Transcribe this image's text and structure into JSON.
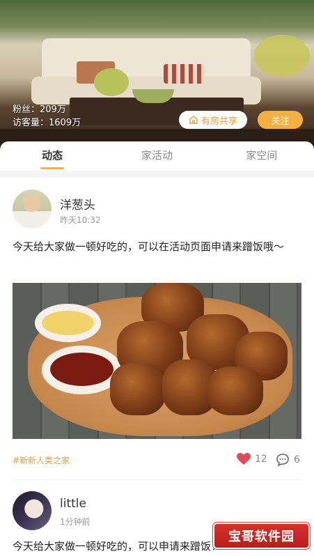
{
  "profile": {
    "fans": "粉丝：209万",
    "visitors": "访客量：1609万",
    "share_label": "有房共享",
    "follow_label": "关注"
  },
  "tabs": [
    {
      "label": "动态",
      "active": true
    },
    {
      "label": "家活动",
      "active": false
    },
    {
      "label": "家空间",
      "active": false
    }
  ],
  "posts": [
    {
      "username": "洋葱头",
      "time": "昨天10:32",
      "text": "今天给大家做一顿好吃的，可以在活动页面申请来蹭饭哦～",
      "tag": "#新新人类之家",
      "likes": "12",
      "comments": "6"
    },
    {
      "username": "little",
      "time": "1分钟前",
      "text": "今天给大家做一顿好吃的，可以申请来蹭饭！"
    }
  ],
  "watermark": "宝哥软件园",
  "colors": {
    "accent": "#f5b13f",
    "like": "#e04a5a",
    "tag": "#d9a04b"
  },
  "icons": {
    "share": "house-icon",
    "like": "heart-icon",
    "comment": "comment-bubble-icon"
  }
}
